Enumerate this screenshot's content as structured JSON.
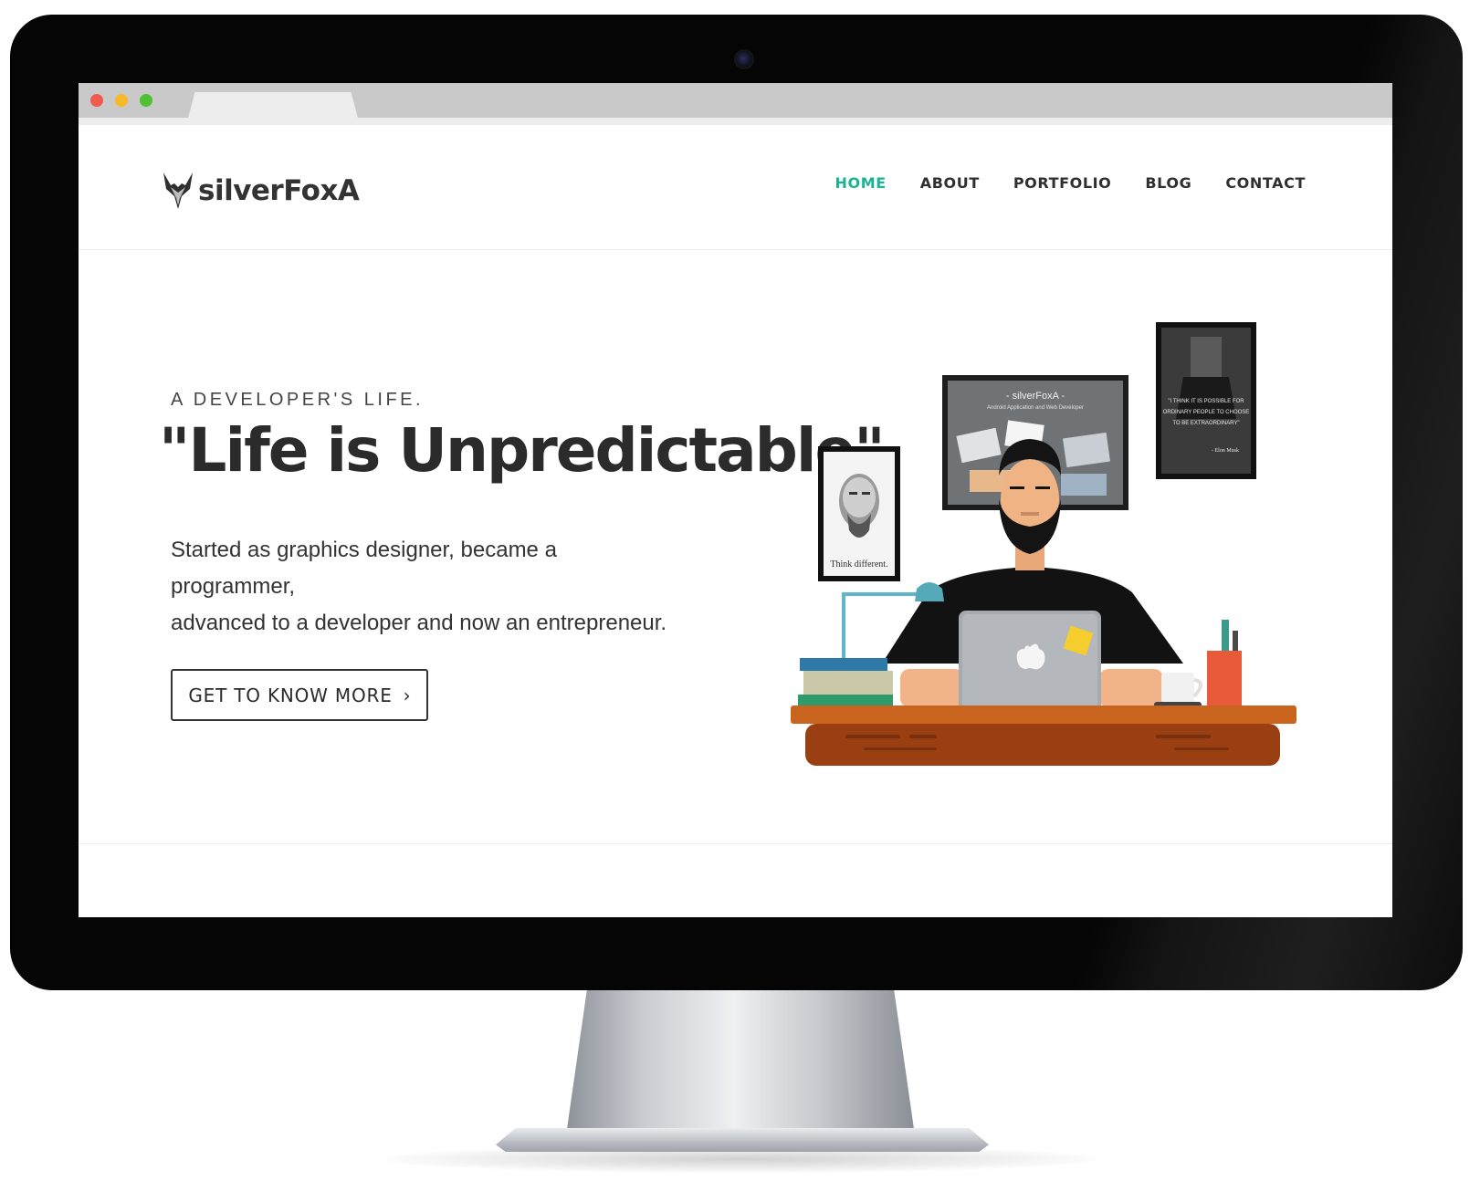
{
  "site": {
    "brand": "silverFoxA",
    "nav": [
      {
        "label": "HOME",
        "active": true
      },
      {
        "label": "ABOUT",
        "active": false
      },
      {
        "label": "PORTFOLIO",
        "active": false
      },
      {
        "label": "BLOG",
        "active": false
      },
      {
        "label": "CONTACT",
        "active": false
      }
    ],
    "accent_color": "#1ab394"
  },
  "hero": {
    "tagline": "A DEVELOPER'S LIFE.",
    "headline": "\"Life is Unpredictable\"",
    "intro_line1": "Started as graphics designer, became a programmer,",
    "intro_line2": "advanced to a developer and now an entrepreneur.",
    "cta_label": "GET TO KNOW MORE",
    "cta_icon": "chevron-right-icon"
  },
  "illustration": {
    "monitor_title": "- silverFoxA -",
    "monitor_subtitle": "Android Application and Web Developer",
    "portrait_caption": "Think different.",
    "quote_line1": "\"I THINK IT IS POSSIBLE FOR",
    "quote_line2": "ORDINARY PEOPLE TO CHOOSE",
    "quote_line3": "TO BE EXTRAORDINARY\"",
    "quote_author": "- Elon Musk"
  }
}
